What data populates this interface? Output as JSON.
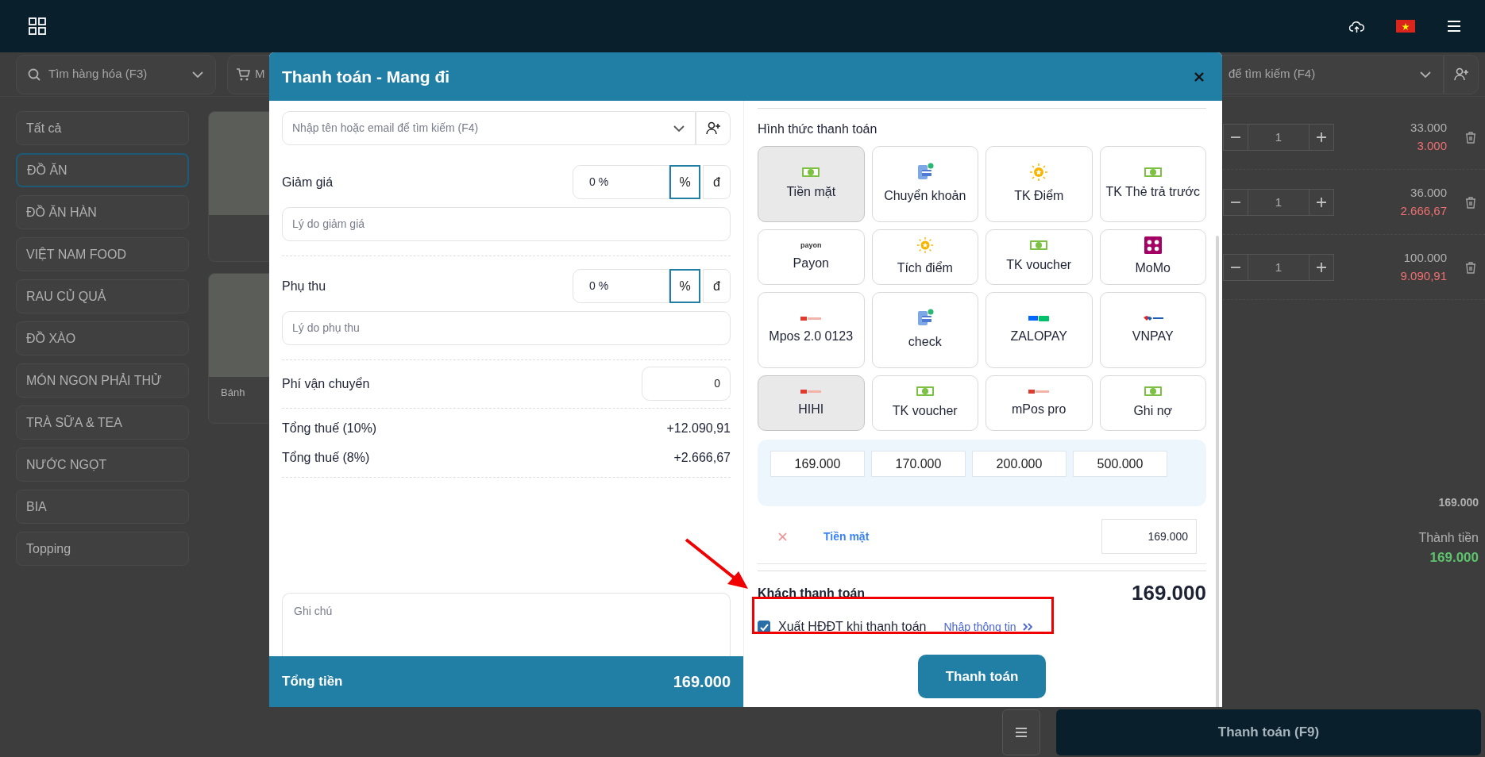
{
  "product_search": {
    "placeholder": "Tìm hàng hóa (F3)"
  },
  "cart_button": {
    "label": "M"
  },
  "customer_search_bg": {
    "placeholder": "để tìm kiếm (F4)"
  },
  "categories": [
    {
      "label": "Tất cả",
      "selected": false
    },
    {
      "label": "ĐỒ ĂN",
      "selected": true
    },
    {
      "label": "ĐỒ ĂN HÀN",
      "selected": false
    },
    {
      "label": "VIỆT NAM FOOD",
      "selected": false
    },
    {
      "label": "RAU CỦ QUẢ",
      "selected": false
    },
    {
      "label": "ĐỒ XÀO",
      "selected": false
    },
    {
      "label": "MÓN NGON PHẢI THỬ",
      "selected": false
    },
    {
      "label": "TRÀ SỮA & TEA",
      "selected": false
    },
    {
      "label": "NƯỚC NGỌT",
      "selected": false
    },
    {
      "label": "BIA",
      "selected": false
    },
    {
      "label": "Topping",
      "selected": false
    }
  ],
  "products": [
    {
      "kind": "photo"
    },
    {
      "kind": "photo",
      "name": "Bánh"
    }
  ],
  "cart_items": [
    {
      "qty": "1",
      "price": "33.000",
      "tax": "3.000"
    },
    {
      "qty": "1",
      "price": "36.000",
      "tax": "2.666,67"
    },
    {
      "qty": "1",
      "price": "100.000",
      "tax": "9.090,91"
    }
  ],
  "cart_subtotal": "169.000",
  "cart_total_label": "Thành tiền",
  "cart_total": "169.000",
  "checkout_button": "Thanh toán (F9)",
  "modal": {
    "title": "Thanh toán - Mang đi",
    "customer_search": {
      "placeholder": "Nhập tên hoặc email để tìm kiếm (F4)"
    },
    "adjustments": [
      {
        "label": "Giảm giá",
        "value": "0 %",
        "units": [
          {
            "label": "%",
            "selected": true
          },
          {
            "label": "đ",
            "selected": false
          }
        ],
        "reason_placeholder": "Lý do giảm giá"
      },
      {
        "label": "Phụ thu",
        "value": "0 %",
        "units": [
          {
            "label": "%",
            "selected": true
          },
          {
            "label": "đ",
            "selected": false
          }
        ],
        "reason_placeholder": "Lý do phụ thu"
      }
    ],
    "shipping": {
      "label": "Phí vận chuyển",
      "value": "0"
    },
    "taxes": [
      {
        "label": "Tổng thuế (10%)",
        "value": "+12.090,91"
      },
      {
        "label": "Tổng thuế (8%)",
        "value": "+2.666,67"
      }
    ],
    "note": {
      "placeholder": "Ghi chú"
    },
    "total": {
      "label": "Tổng tiền",
      "value": "169.000"
    },
    "methods_title": "Hình thức thanh toán",
    "methods": [
      {
        "label": "Tiền mặt",
        "kind": "cash",
        "selected": true
      },
      {
        "label": "Chuyển khoản",
        "kind": "transfer",
        "selected": false
      },
      {
        "label": "TK Điểm",
        "kind": "points",
        "selected": false
      },
      {
        "label": "TK Thẻ trả trước",
        "kind": "cash",
        "selected": false
      },
      {
        "label": "Payon",
        "kind": "payon",
        "logo_text": "payon",
        "selected": false
      },
      {
        "label": "Tích điểm",
        "kind": "points",
        "selected": false
      },
      {
        "label": "TK voucher",
        "kind": "cash",
        "selected": false
      },
      {
        "label": "MoMo",
        "kind": "momo",
        "selected": false
      },
      {
        "label": "Mpos 2.0 0123",
        "kind": "mpos",
        "selected": false
      },
      {
        "label": "check",
        "kind": "transfer",
        "selected": false
      },
      {
        "label": "ZALOPAY",
        "kind": "zalopay",
        "selected": false
      },
      {
        "label": "VNPAY",
        "kind": "vnpay",
        "selected": false
      },
      {
        "label": "HIHI",
        "kind": "mpos",
        "selected": true
      },
      {
        "label": "TK voucher",
        "kind": "cash",
        "selected": false
      },
      {
        "label": "mPos pro",
        "kind": "mpos",
        "selected": false
      },
      {
        "label": "Ghi nợ",
        "kind": "cash",
        "selected": false
      }
    ],
    "quick_amounts": [
      "169.000",
      "170.000",
      "200.000",
      "500.000"
    ],
    "payments": [
      {
        "method": "Tiền mặt",
        "amount": "169.000"
      }
    ],
    "customer_pays": {
      "label": "Khách thanh toán",
      "value": "169.000"
    },
    "einvoice": {
      "label": "Xuất HĐĐT khi thanh toán",
      "checked": true,
      "link": "Nhập thông tin"
    },
    "pay_button": "Thanh toán"
  }
}
